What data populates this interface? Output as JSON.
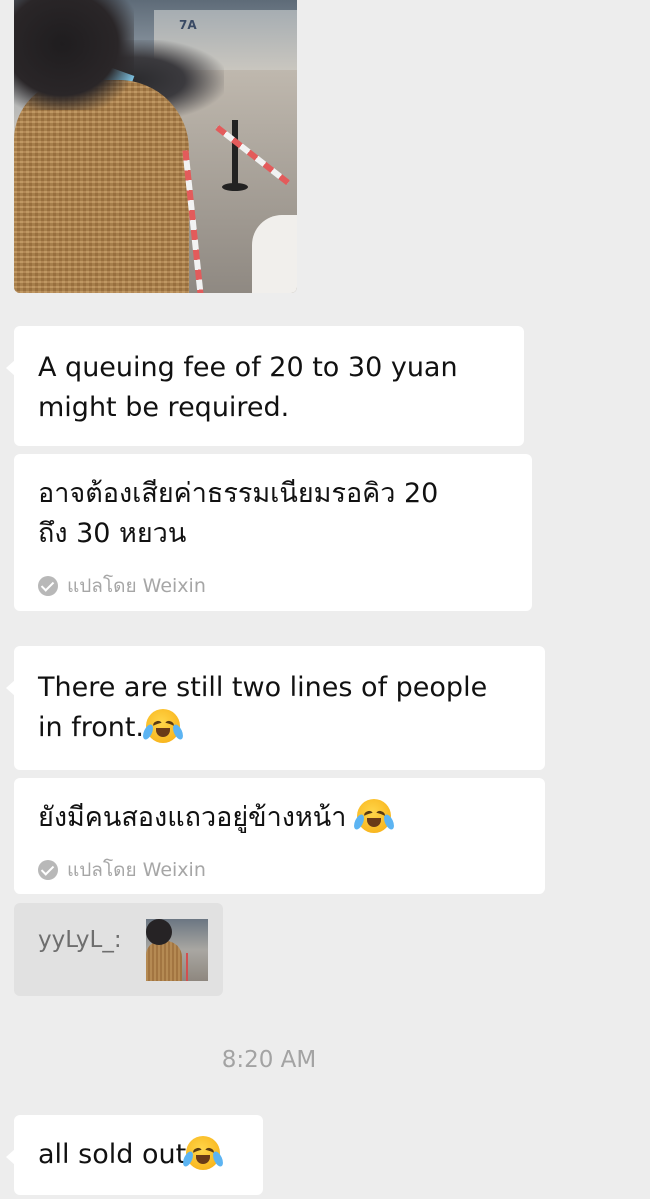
{
  "photo": {
    "sign_text": "7A"
  },
  "messages": [
    {
      "id": "m1",
      "lines": [
        "A queuing fee of 20 to 30 yuan",
        "might be required."
      ]
    },
    {
      "id": "t1",
      "lines": [
        "อาจต้องเสียค่าธรรมเนียมรอคิว 20",
        "ถึง 30 หยวน"
      ],
      "translated_by": "แปลโดย Weixin"
    },
    {
      "id": "m2",
      "lines": [
        "There are still two lines of people",
        "in front."
      ]
    },
    {
      "id": "t2",
      "lines": [
        "ยังมีคนสองแถวอยู่ข้างหน้า "
      ],
      "translated_by": "แปลโดย Weixin"
    }
  ],
  "quote": {
    "sender": "yyLyL_:"
  },
  "timestamp": "8:20 AM",
  "last_message": {
    "text": "all sold out"
  },
  "icons": {
    "check": "check-circle-icon",
    "emoji": "crying-laughing-emoji-icon"
  },
  "colors": {
    "background": "#ededed",
    "bubble": "#ffffff",
    "quote_bg": "#e1e1e1",
    "meta_text": "#a6a6a6"
  }
}
